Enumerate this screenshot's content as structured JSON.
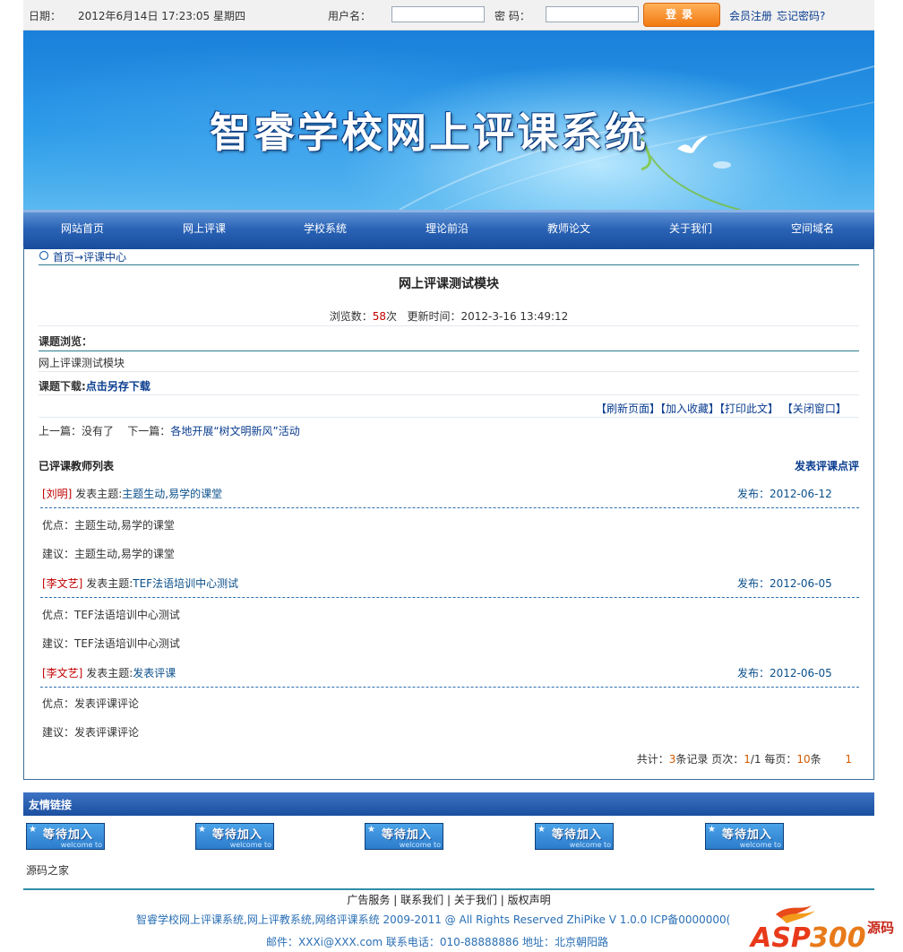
{
  "topbar": {
    "date_label": "日期：",
    "date_value": "2012年6月14日  17:23:05 星期四",
    "username_label": "用户名：",
    "password_label": "密  码：",
    "username_value": "",
    "password_value": "",
    "login_label": "登录",
    "register_link": "会员注册",
    "forgot_link": "忘记密码?"
  },
  "banner": {
    "title": "智睿学校网上评课系统"
  },
  "nav": {
    "items": [
      "网站首页",
      "网上评课",
      "学校系统",
      "理论前沿",
      "教师论文",
      "关于我们",
      "空间域名"
    ]
  },
  "breadcrumb": {
    "home": "首页",
    "arrow": "→",
    "current": "评课中心"
  },
  "article": {
    "title": "网上评课测试模块",
    "views_label": "浏览数：",
    "views": "58",
    "views_unit": "次",
    "updated_label": "更新时间：",
    "updated": "2012-3-16 13:49:12",
    "browse_label": "课题浏览：",
    "browse_text": "网上评课测试模块",
    "download_label": "课题下载:",
    "download_link": "点击另存下载",
    "actions": [
      "【刷新页面】",
      "【加入收藏】",
      "【打印此文】",
      "【关闭窗口】"
    ],
    "prev_label": "上一篇：",
    "prev_value": "没有了",
    "next_label": "下一篇：",
    "next_value": "各地开展“树文明新风”活动"
  },
  "reviews": {
    "list_title": "已评课教师列表",
    "post_link": "发表评课点评",
    "topic_label": "发表主题:",
    "pro_label": "优点：",
    "advice_label": "建议：",
    "date_label": "发布：",
    "items": [
      {
        "author": "[刘明]",
        "topic": "主题生动,易学的课堂",
        "date": "2012-06-12",
        "pro": "主题生动,易学的课堂",
        "advice": "主题生动,易学的课堂"
      },
      {
        "author": "[李文艺]",
        "topic": "TEF法语培训中心测试",
        "date": "2012-06-05",
        "pro": "TEF法语培训中心测试",
        "advice": "TEF法语培训中心测试"
      },
      {
        "author": "[李文艺]",
        "topic": "发表评课",
        "date": "2012-06-05",
        "pro": "发表评课评论",
        "advice": "发表评课评论"
      }
    ]
  },
  "pagination": {
    "total_label": "共计：",
    "total": "3",
    "records_label": "条记录 页次：",
    "page": "1",
    "pages": "/1",
    "per_page_label": " 每页：",
    "per_page": "10",
    "unit": "条",
    "page_link": "1"
  },
  "friend_links": {
    "title": "友情链接",
    "ad_big": "等待加入",
    "ad_small": "welcome to",
    "text_link": "源码之家"
  },
  "footer": {
    "links": [
      "广告服务",
      "联系我们",
      "关于我们",
      "版权声明"
    ],
    "separator": "|",
    "copyright": "智睿学校网上评课系统,网上评教系统,网络评课系统  2009-2011 @ All Rights Reserved ZhiPike V 1.0.0 ICP备0000000(",
    "contact": "邮件：XXXi@XXX.com 联系电话：010-88888886    地址：北京朝阳路"
  },
  "watermark": {
    "text": "ASP300",
    "suffix": "源码"
  },
  "colors": {
    "nav_blue": "#1f5aa8",
    "accent_orange": "#f27a12",
    "link_blue": "#0a3d8f",
    "author_red": "#c20000"
  }
}
